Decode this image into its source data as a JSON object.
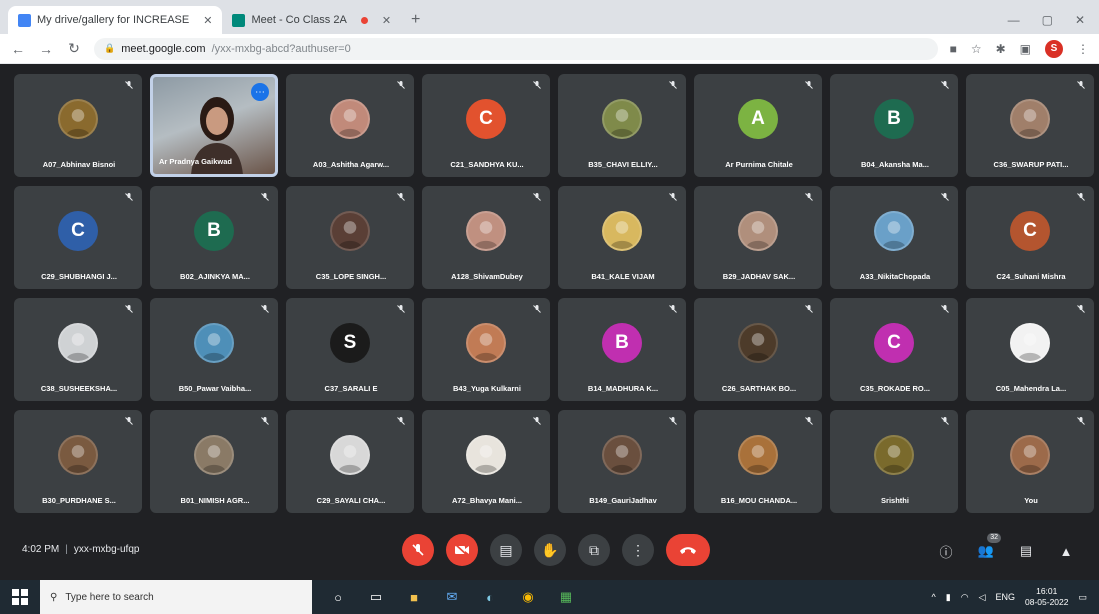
{
  "browser": {
    "tabs": [
      {
        "title": "My drive/gallery for INCREASE",
        "active": true
      },
      {
        "title": "Meet - Co Class 2A",
        "active": false
      }
    ],
    "url": "meet.google.com",
    "url_path": "/yxx-mxbg-abcd?authuser=0",
    "profile_initial": "S"
  },
  "colors": {
    "accent": "#1a73e8",
    "danger": "#ea4335",
    "tile": "#3c4043",
    "bg": "#202124"
  },
  "participants": [
    {
      "name": "A07_Abhinav Bisnoi",
      "avatar": "photo",
      "color": "#8a6a2e"
    },
    {
      "name": "Ar Pradnya Gaikwad",
      "avatar": "video",
      "color": "#9aa4ab"
    },
    {
      "name": "A03_Ashitha Agarw...",
      "avatar": "photo",
      "color": "#c18a7a"
    },
    {
      "name": "C21_SANDHYA KU...",
      "avatar": "C",
      "color": "#e2522e"
    },
    {
      "name": "B35_CHAVI ELLIY...",
      "avatar": "photo",
      "color": "#7f8a4a"
    },
    {
      "name": "Ar Purnima Chitale",
      "avatar": "A",
      "color": "#7cb342"
    },
    {
      "name": "B04_Akansha Ma...",
      "avatar": "B",
      "color": "#1e6b50"
    },
    {
      "name": "C36_SWARUP PATI...",
      "avatar": "photo",
      "color": "#a07f6a"
    },
    {
      "name": "C29_SHUBHANGI J...",
      "avatar": "C",
      "color": "#2f5fa8"
    },
    {
      "name": "B02_AJINKYA MA...",
      "avatar": "B",
      "color": "#1e6b50"
    },
    {
      "name": "C35_LOPE SINGH...",
      "avatar": "photo",
      "color": "#5a3f36"
    },
    {
      "name": "A128_ShivamDubey",
      "avatar": "photo",
      "color": "#c09080"
    },
    {
      "name": "B41_KALE VIJAM",
      "avatar": "photo",
      "color": "#d8b85f"
    },
    {
      "name": "B29_JADHAV SAK...",
      "avatar": "photo",
      "color": "#b08f7c"
    },
    {
      "name": "A33_NikitaChopada",
      "avatar": "photo",
      "color": "#6aa0c8"
    },
    {
      "name": "C24_Suhani Mishra",
      "avatar": "C",
      "color": "#b4552f"
    },
    {
      "name": "C38_SUSHEEKSHA...",
      "avatar": "photo",
      "color": "#cfd2d4"
    },
    {
      "name": "B50_Pawar Vaibha...",
      "avatar": "photo",
      "color": "#4e8fb8"
    },
    {
      "name": "C37_SARALI E",
      "avatar": "S",
      "color": "#1b1b1b"
    },
    {
      "name": "B43_Yuga Kulkarni",
      "avatar": "photo",
      "color": "#c17b55"
    },
    {
      "name": "B14_MADHURA K...",
      "avatar": "B",
      "color": "#c02fb0"
    },
    {
      "name": "C26_SARTHAK BO...",
      "avatar": "photo",
      "color": "#4d3b2a"
    },
    {
      "name": "C35_ROKADE RO...",
      "avatar": "C",
      "color": "#c02fb0"
    },
    {
      "name": "C05_Mahendra La...",
      "avatar": "photo",
      "color": "#f2f2f2"
    },
    {
      "name": "B30_PURDHANE S...",
      "avatar": "photo",
      "color": "#7a5a40"
    },
    {
      "name": "B01_NIMISH AGR...",
      "avatar": "photo",
      "color": "#8a7a66"
    },
    {
      "name": "C29_SAYALI CHA...",
      "avatar": "photo",
      "color": "#d8d8d8"
    },
    {
      "name": "A72_Bhavya Mani...",
      "avatar": "photo",
      "color": "#e8e4dd"
    },
    {
      "name": "B149_GauriJadhav",
      "avatar": "photo",
      "color": "#6a4f3e"
    },
    {
      "name": "B16_MOU CHANDA...",
      "avatar": "photo",
      "color": "#a9713a"
    },
    {
      "name": "Srishthi",
      "avatar": "photo",
      "color": "#7a6a2c"
    },
    {
      "name": "You",
      "avatar": "photo",
      "color": "#9c6a4a"
    }
  ],
  "bottom": {
    "time": "4:02 PM",
    "meeting_code": "yxx-mxbg-ufqp",
    "people_count": "32"
  },
  "taskbar": {
    "search_placeholder": "Type here to search",
    "clock_time": "16:01",
    "clock_date": "08-05-2022",
    "lang": "ENG"
  }
}
